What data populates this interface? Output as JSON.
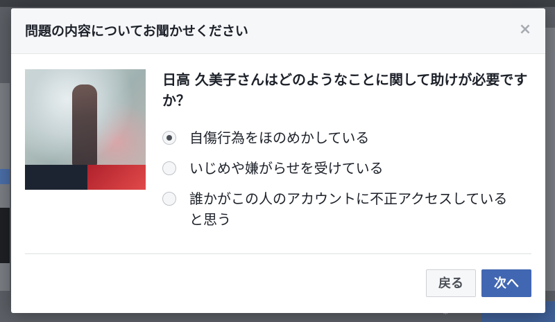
{
  "dialog": {
    "title": "問題の内容についてお聞かせください",
    "close_icon": "close-icon",
    "question": "日高 久美子さんはどのようなことに関して助けが必要ですか？",
    "options": [
      {
        "label": "自傷行為をほのめかしている",
        "selected": true
      },
      {
        "label": "いじめや嫌がらせを受けている",
        "selected": false
      },
      {
        "label": "誰かがこの人のアカウントに不正アクセスしていると思う",
        "selected": false
      }
    ],
    "back_label": "戻る",
    "next_label": "次へ"
  },
  "colors": {
    "primary_button": "#4267b2",
    "header_bg": "#f6f7f9"
  }
}
